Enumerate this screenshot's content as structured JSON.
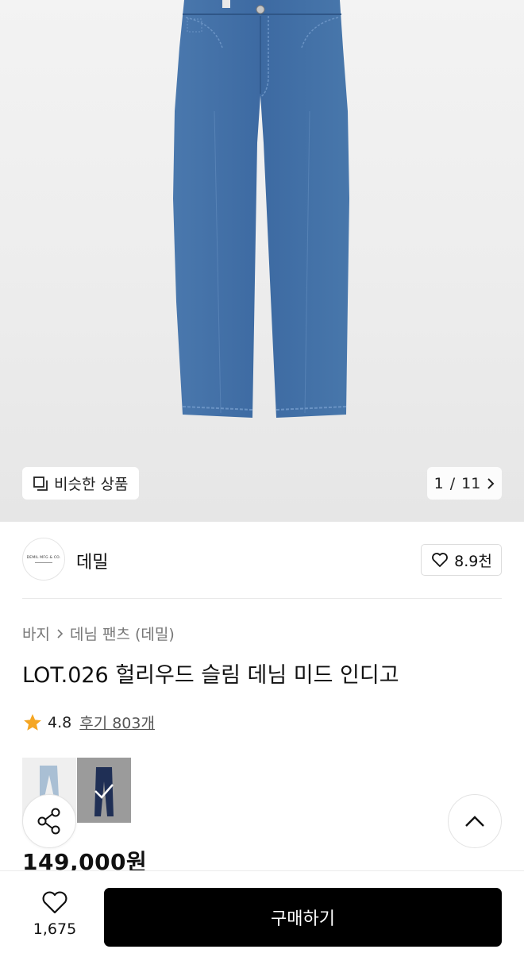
{
  "gallery": {
    "similar_label": "비슷한 상품",
    "current": "1",
    "sep": "/",
    "total": "11"
  },
  "brand": {
    "logo_text": "DEMIL MFG & CO.",
    "name": "데밀",
    "likes": "8.9천"
  },
  "breadcrumb": {
    "category": "바지",
    "subcategory": "데님 팬츠 (데밀)"
  },
  "product": {
    "title": "LOT.026 헐리우드 슬림 데님 미드 인디고",
    "rating": "4.8",
    "reviews": "후기 803개",
    "price": "149,000원"
  },
  "bottom": {
    "like_count": "1,675",
    "buy_label": "구매하기"
  },
  "colors": {
    "denim": "#3f6ea6",
    "star": "#f5a623",
    "buy_button": "#000000"
  }
}
